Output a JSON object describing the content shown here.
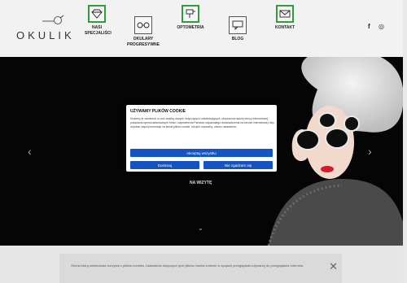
{
  "brand": {
    "name": "OKULIK"
  },
  "nav": [
    {
      "label": "NASI SPECJALIŚCI",
      "icon": "diamond-icon",
      "active": true
    },
    {
      "label": "OKULARY PROGRESYWNE",
      "icon": "glasses-icon",
      "active": false
    },
    {
      "label": "OPTOMETRIA",
      "icon": "eye-chart-icon",
      "active": true
    },
    {
      "label": "BLOG",
      "icon": "speech-bubble-icon",
      "active": false
    },
    {
      "label": "KONTAKT",
      "icon": "envelope-icon",
      "active": true
    }
  ],
  "social": {
    "facebook": "f",
    "instagram": "◎"
  },
  "hero": {
    "cta": "NA WIZYTĘ",
    "prev": "‹",
    "next": "›",
    "scroll": "⌄"
  },
  "cookie_modal": {
    "title": "UŻYWAMY PLIKÓW COOKIE",
    "text": "Możemy je zamieścić w celu analizy danych dotyczących odwiedzających, ulepszenia naszej strony internetowej, pokazania spersonalizowanych treści i zapewnienia Państwu wspaniałego doświadczenia na stronie internetowej. Aby uzyskać więcej informacji na temat plików cookie, których używamy, otwórz ustawienia.",
    "accept_all": "Akceptuj wszystko",
    "customize": "Dostosuj",
    "reject": "Nie zgadzam się"
  },
  "notice": {
    "text": "Strona którą odwiedzasz korzysta z plików cookies. Ustawienia dotyczące tych plików można zmienić w opcjach przeglądarki używanej do przeglądania Internetu.",
    "close": "✕"
  },
  "colors": {
    "active_border": "#2e9e3a",
    "button": "#1553c2",
    "hero_bg": "#050505"
  }
}
